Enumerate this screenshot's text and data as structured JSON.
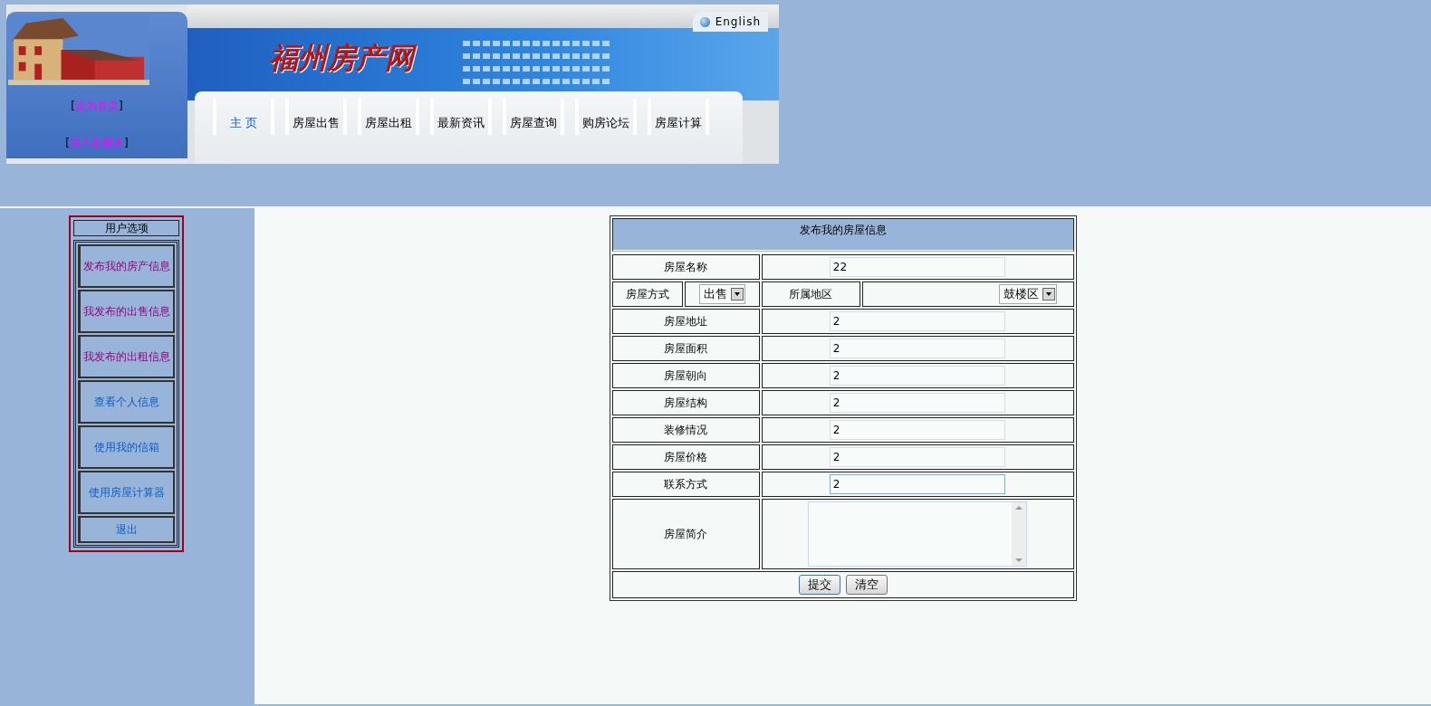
{
  "header": {
    "links": [
      {
        "open": "[",
        "label": "设为首页",
        "close": "]"
      },
      {
        "open": "[",
        "label": "加入收藏夹",
        "close": "]"
      }
    ],
    "logo": "福州房产网",
    "language": "English",
    "nav": [
      {
        "label": "主 页",
        "selected": true
      },
      {
        "label": "房屋出售",
        "selected": false
      },
      {
        "label": "房屋出租",
        "selected": false
      },
      {
        "label": "最新资讯",
        "selected": false
      },
      {
        "label": "房屋查询",
        "selected": false
      },
      {
        "label": "购房论坛",
        "selected": false
      },
      {
        "label": "房屋计算",
        "selected": false
      }
    ]
  },
  "sidebar": {
    "title": "用户选项",
    "items": [
      {
        "label": "发布我的房产信息",
        "visited": true
      },
      {
        "label": "我发布的出售信息",
        "visited": true
      },
      {
        "label": "我发布的出租信息",
        "visited": true
      },
      {
        "label": "查看个人信息",
        "visited": false
      },
      {
        "label": "使用我的信箱",
        "visited": false
      },
      {
        "label": "使用房屋计算器",
        "visited": false
      },
      {
        "label": "退出",
        "visited": false
      }
    ]
  },
  "form": {
    "title": "发布我的房屋信息",
    "rows": [
      {
        "kind": "text",
        "label": "房屋名称",
        "value": "22",
        "focused": false
      },
      {
        "kind": "selects",
        "label": "房屋方式",
        "select": "出售",
        "label_2": "所属地区",
        "select_2": "鼓楼区"
      },
      {
        "kind": "text",
        "label": "房屋地址",
        "value": "2",
        "focused": false
      },
      {
        "kind": "text",
        "label": "房屋面积",
        "value": "2",
        "focused": false
      },
      {
        "kind": "text",
        "label": "房屋朝向",
        "value": "2",
        "focused": false
      },
      {
        "kind": "text",
        "label": "房屋结构",
        "value": "2",
        "focused": false
      },
      {
        "kind": "text",
        "label": "装修情况",
        "value": "2",
        "focused": false
      },
      {
        "kind": "text",
        "label": "房屋价格",
        "value": "2",
        "focused": false
      },
      {
        "kind": "text",
        "label": "联系方式",
        "value": "2",
        "focused": true
      },
      {
        "kind": "textarea",
        "label": "房屋简介"
      }
    ],
    "buttons": [
      {
        "label": "提交",
        "focused": true
      },
      {
        "label": "清空",
        "focused": false
      }
    ]
  }
}
